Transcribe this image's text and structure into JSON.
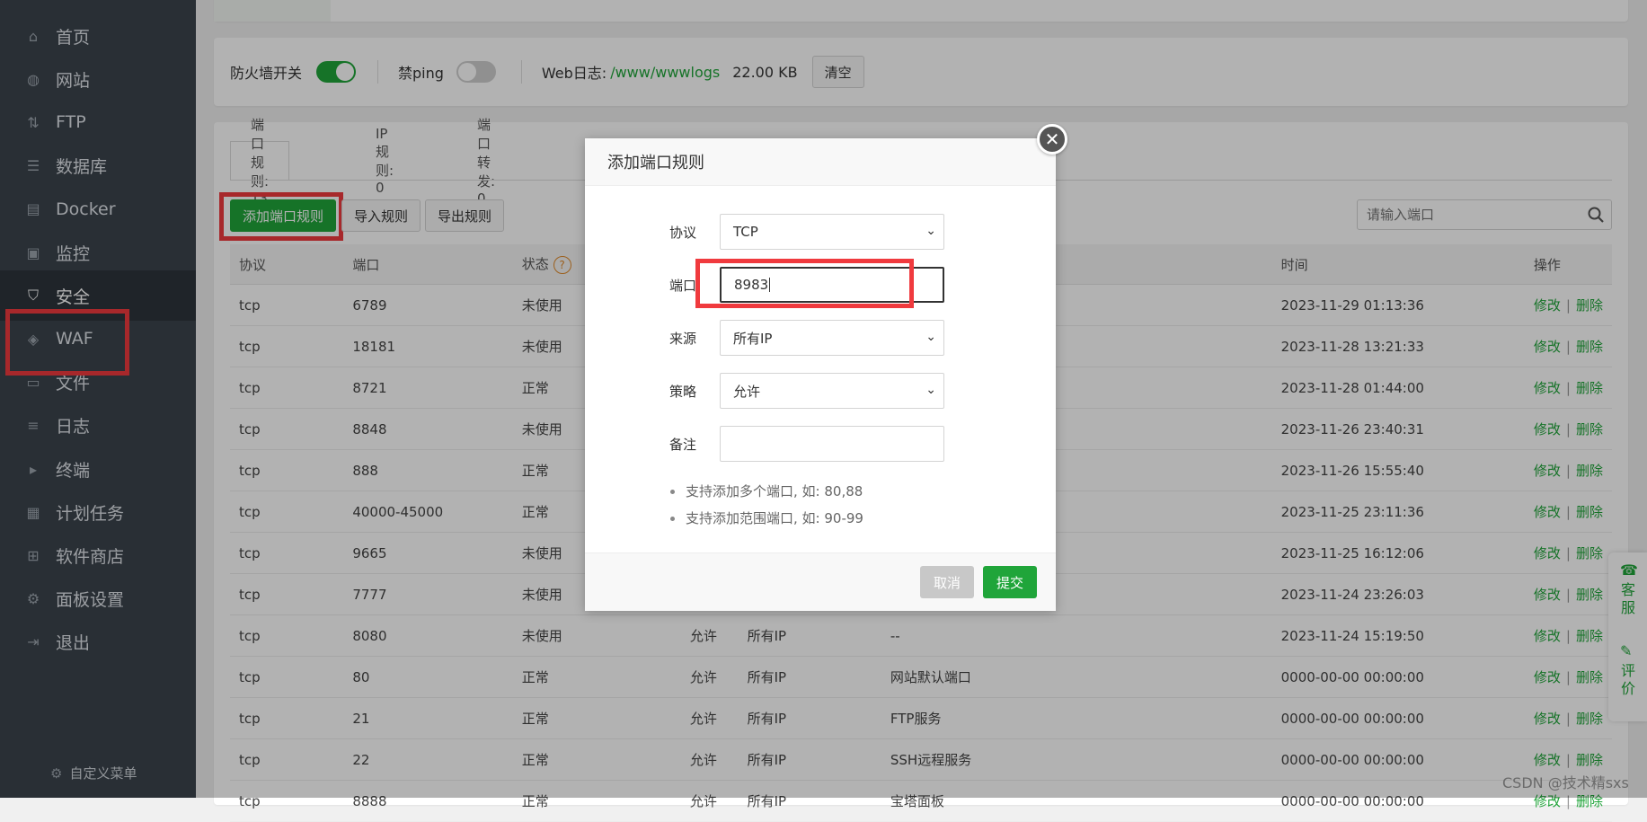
{
  "sidebar": {
    "items": [
      {
        "label": "首页",
        "icon": "home-icon"
      },
      {
        "label": "网站",
        "icon": "globe-icon"
      },
      {
        "label": "FTP",
        "icon": "ftp-icon"
      },
      {
        "label": "数据库",
        "icon": "database-icon"
      },
      {
        "label": "Docker",
        "icon": "docker-icon"
      },
      {
        "label": "监控",
        "icon": "monitor-icon"
      },
      {
        "label": "安全",
        "icon": "shield-icon"
      },
      {
        "label": "WAF",
        "icon": "waf-icon"
      },
      {
        "label": "文件",
        "icon": "folder-icon"
      },
      {
        "label": "日志",
        "icon": "log-icon"
      },
      {
        "label": "终端",
        "icon": "terminal-icon"
      },
      {
        "label": "计划任务",
        "icon": "calendar-icon"
      },
      {
        "label": "软件商店",
        "icon": "grid-icon"
      },
      {
        "label": "面板设置",
        "icon": "settings-icon"
      },
      {
        "label": "退出",
        "icon": "logout-icon"
      }
    ],
    "footer": "自定义菜单"
  },
  "firewall": {
    "switch_label": "防火墙开关",
    "ping_label": "禁ping",
    "weblog_label": "Web日志:",
    "weblog_path": "/www/wwwlogs",
    "weblog_size": "22.00 KB",
    "clear_label": "清空"
  },
  "rule_tabs": [
    "端口规则: 13",
    "IP规则: 0",
    "端口转发: 0"
  ],
  "toolbar": {
    "add_label": "添加端口规则",
    "import_label": "导入规则",
    "export_label": "导出规则",
    "search_placeholder": "请输入端口"
  },
  "table": {
    "headers": {
      "protocol": "协议",
      "port": "端口",
      "status": "状态",
      "time": "时间",
      "ops": "操作"
    },
    "edit_label": "修改",
    "delete_label": "删除",
    "rows": [
      {
        "protocol": "tcp",
        "port": "6789",
        "status": "未使用",
        "policy": "",
        "source": "",
        "remark": "",
        "time": "2023-11-29 01:13:36"
      },
      {
        "protocol": "tcp",
        "port": "18181",
        "status": "未使用",
        "policy": "",
        "source": "",
        "remark": "",
        "time": "2023-11-28 13:21:33"
      },
      {
        "protocol": "tcp",
        "port": "8721",
        "status": "正常",
        "policy": "",
        "source": "",
        "remark": "",
        "time": "2023-11-28 01:44:00"
      },
      {
        "protocol": "tcp",
        "port": "8848",
        "status": "未使用",
        "policy": "",
        "source": "",
        "remark": "",
        "time": "2023-11-26 23:40:31"
      },
      {
        "protocol": "tcp",
        "port": "888",
        "status": "正常",
        "policy": "",
        "source": "",
        "remark": "",
        "time": "2023-11-26 15:55:40"
      },
      {
        "protocol": "tcp",
        "port": "40000-45000",
        "status": "正常",
        "policy": "",
        "source": "",
        "remark": "",
        "time": "2023-11-25 23:11:36"
      },
      {
        "protocol": "tcp",
        "port": "9665",
        "status": "未使用",
        "policy": "",
        "source": "",
        "remark": "",
        "time": "2023-11-25 16:12:06"
      },
      {
        "protocol": "tcp",
        "port": "7777",
        "status": "未使用",
        "policy": "",
        "source": "",
        "remark": "",
        "time": "2023-11-24 23:26:03"
      },
      {
        "protocol": "tcp",
        "port": "8080",
        "status": "未使用",
        "policy": "允许",
        "source": "所有IP",
        "remark": "--",
        "time": "2023-11-24 15:19:50"
      },
      {
        "protocol": "tcp",
        "port": "80",
        "status": "正常",
        "policy": "允许",
        "source": "所有IP",
        "remark": "网站默认端口",
        "time": "0000-00-00 00:00:00"
      },
      {
        "protocol": "tcp",
        "port": "21",
        "status": "正常",
        "policy": "允许",
        "source": "所有IP",
        "remark": "FTP服务",
        "time": "0000-00-00 00:00:00"
      },
      {
        "protocol": "tcp",
        "port": "22",
        "status": "正常",
        "policy": "允许",
        "source": "所有IP",
        "remark": "SSH远程服务",
        "time": "0000-00-00 00:00:00"
      },
      {
        "protocol": "tcp",
        "port": "8888",
        "status": "正常",
        "policy": "允许",
        "source": "所有IP",
        "remark": "宝塔面板",
        "time": "0000-00-00 00:00:00"
      }
    ]
  },
  "modal": {
    "title": "添加端口规则",
    "protocol_label": "协议",
    "protocol_value": "TCP",
    "port_label": "端口",
    "port_value": "8983",
    "source_label": "来源",
    "source_value": "所有IP",
    "policy_label": "策略",
    "policy_value": "允许",
    "remark_label": "备注",
    "remark_value": "",
    "tips": [
      "支持添加多个端口, 如: 80,88",
      "支持添加范围端口, 如: 90-99"
    ],
    "cancel_label": "取消",
    "submit_label": "提交"
  },
  "float": {
    "service_label": "客服",
    "review_label": "评价"
  },
  "watermark": "CSDN @技术精sxs",
  "colors": {
    "accent": "#20a53a",
    "sidebar": "#3c444d",
    "highlight": "#f03a3e"
  }
}
